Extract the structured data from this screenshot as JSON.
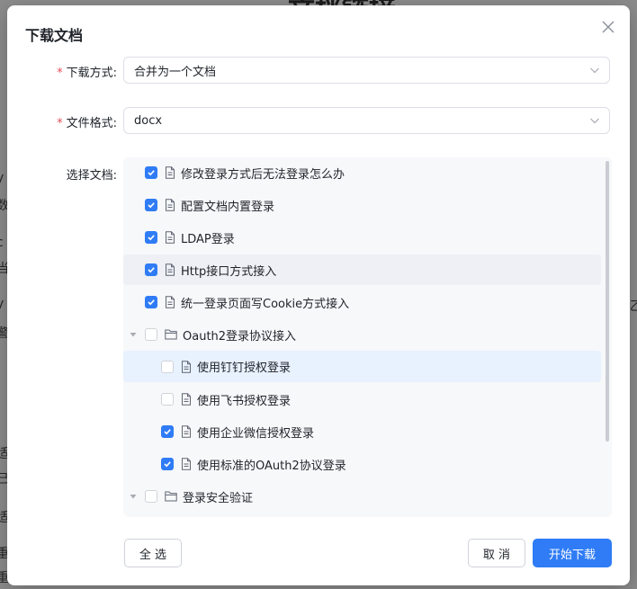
{
  "background": {
    "title_fragment": "文档链接",
    "side_fragments": [
      "y",
      "数",
      "c",
      "当",
      "y",
      "警",
      "i",
      "适",
      "已",
      "适",
      "乙",
      "重",
      "重"
    ]
  },
  "dialog": {
    "title": "下载文档",
    "close_icon": "close-icon",
    "download_mode": {
      "label": "下载方式:",
      "required_mark": "*",
      "value": "合并为一个文档"
    },
    "file_format": {
      "label": "文件格式:",
      "required_mark": "*",
      "value": "docx"
    },
    "select_docs": {
      "label": "选择文档:"
    },
    "tree": [
      {
        "label": "修改登录方式后无法登录怎么办",
        "checked": true,
        "type": "doc",
        "level": 0
      },
      {
        "label": "配置文档内置登录",
        "checked": true,
        "type": "doc",
        "level": 0
      },
      {
        "label": "LDAP登录",
        "checked": true,
        "type": "doc",
        "level": 0
      },
      {
        "label": "Http接口方式接入",
        "checked": true,
        "type": "doc",
        "level": 0
      },
      {
        "label": "统一登录页面写Cookie方式接入",
        "checked": true,
        "type": "doc",
        "level": 0
      },
      {
        "label": "Oauth2登录协议接入",
        "checked": false,
        "type": "folder",
        "level": 0
      },
      {
        "label": "使用钉钉授权登录",
        "checked": false,
        "type": "doc",
        "level": 1
      },
      {
        "label": "使用飞书授权登录",
        "checked": false,
        "type": "doc",
        "level": 1
      },
      {
        "label": "使用企业微信授权登录",
        "checked": true,
        "type": "doc",
        "level": 1
      },
      {
        "label": "使用标准的OAuth2协议登录",
        "checked": true,
        "type": "doc",
        "level": 1
      },
      {
        "label": "登录安全验证",
        "checked": false,
        "type": "folder",
        "level": 0
      }
    ],
    "buttons": {
      "select_all": "全 选",
      "cancel": "取 消",
      "start": "开始下载"
    }
  },
  "colors": {
    "primary": "#2f7cf6",
    "required": "#e34d59"
  }
}
